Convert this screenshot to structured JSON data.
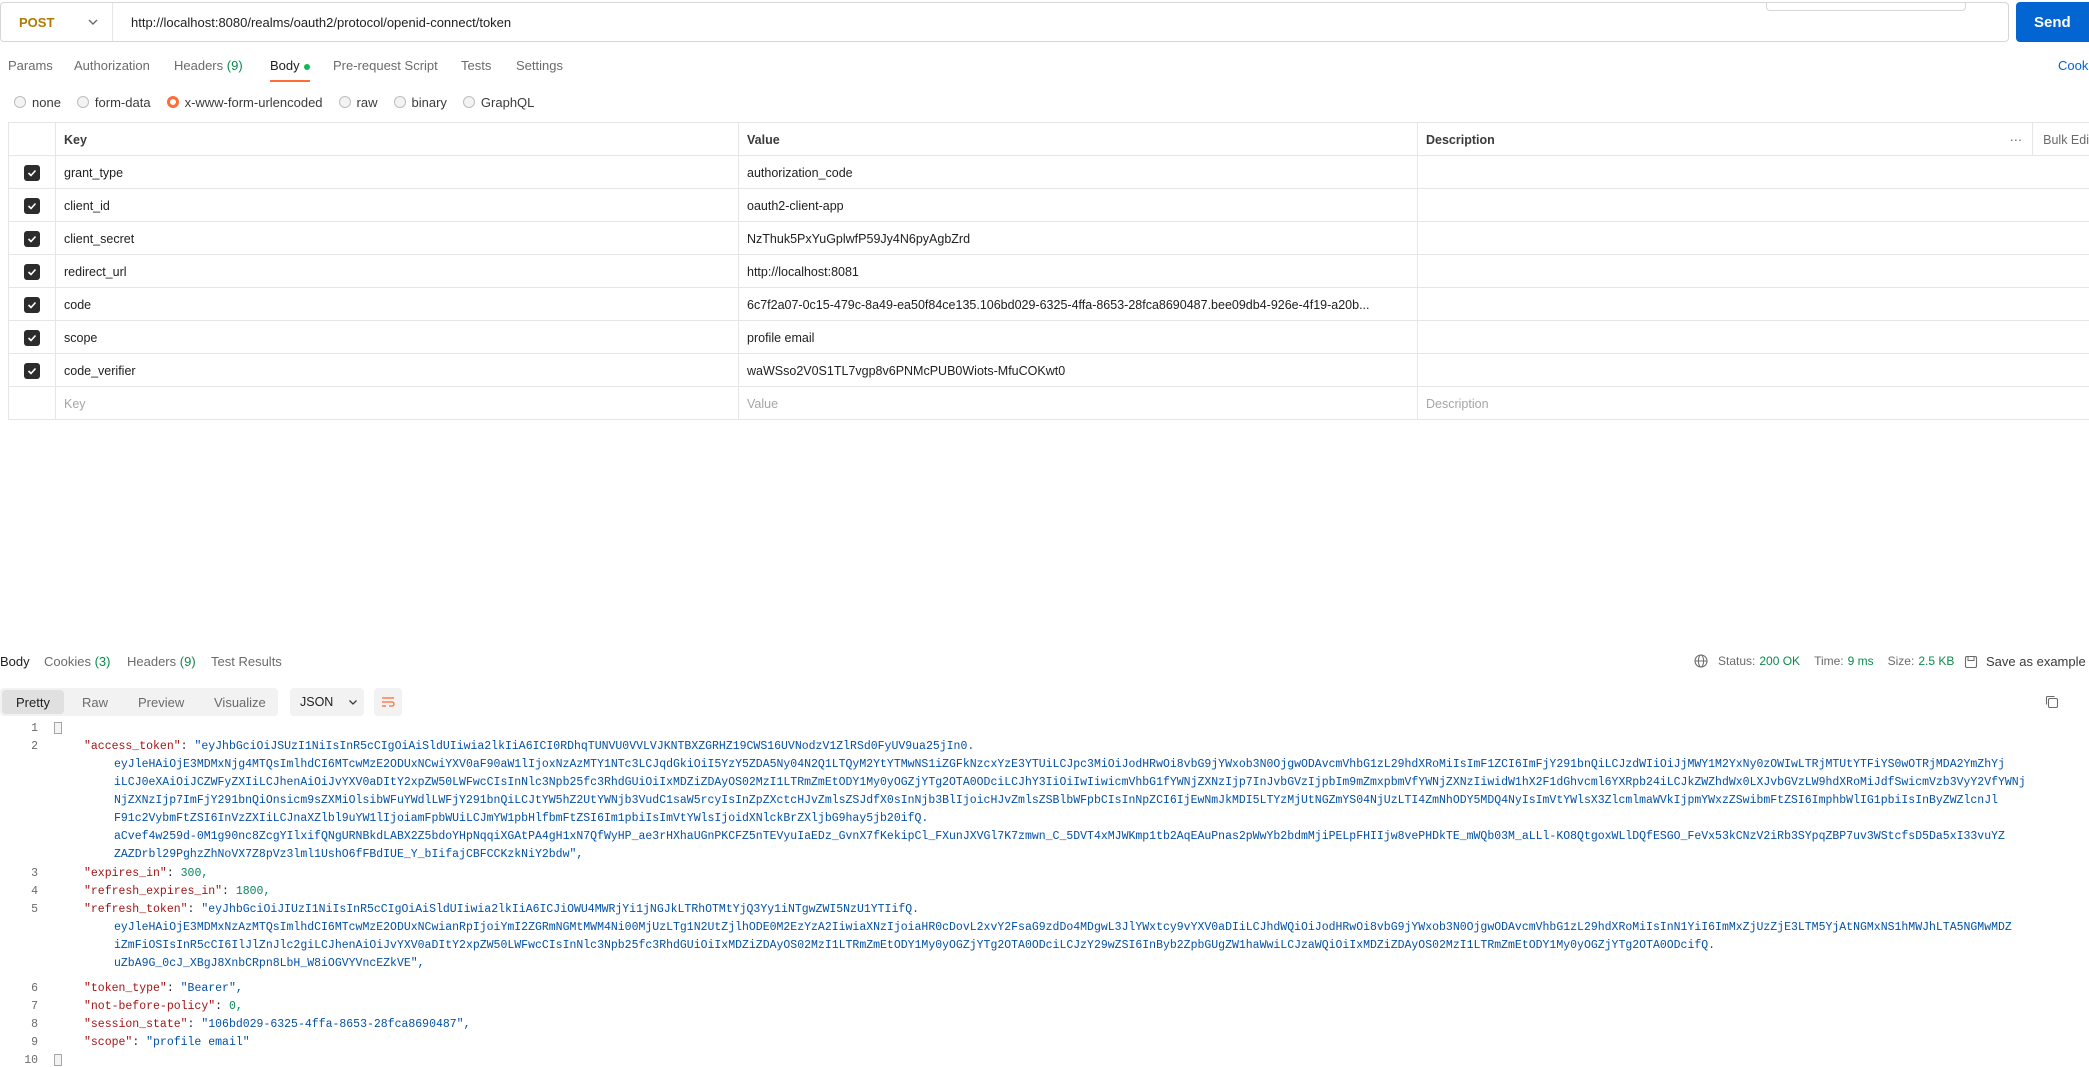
{
  "request": {
    "method": "POST",
    "url": "http://localhost:8080/realms/oauth2/protocol/openid-connect/token",
    "send_label": "Send"
  },
  "tabs": [
    {
      "label": "Params"
    },
    {
      "label": "Authorization"
    },
    {
      "label": "Headers",
      "count": "(9)"
    },
    {
      "label": "Body"
    },
    {
      "label": "Pre-request Script"
    },
    {
      "label": "Tests"
    },
    {
      "label": "Settings"
    }
  ],
  "cookies_label": "Cooki",
  "body_types": [
    "none",
    "form-data",
    "x-www-form-urlencoded",
    "raw",
    "binary",
    "GraphQL"
  ],
  "selected_body_type": "x-www-form-urlencoded",
  "table": {
    "headers": {
      "key": "Key",
      "value": "Value",
      "description": "Description",
      "bulk": "Bulk Edi"
    },
    "rows": [
      {
        "key": "grant_type",
        "value": "authorization_code"
      },
      {
        "key": "client_id",
        "value": "oauth2-client-app"
      },
      {
        "key": "client_secret",
        "value": "NzThuk5PxYuGplwfP59Jy4N6pyAgbZrd"
      },
      {
        "key": "redirect_url",
        "value": "http://localhost:8081"
      },
      {
        "key": "code",
        "value": "6c7f2a07-0c15-479c-8a49-ea50f84ce135.106bd029-6325-4ffa-8653-28fca8690487.bee09db4-926e-4f19-a20b..."
      },
      {
        "key": "scope",
        "value": "profile email"
      },
      {
        "key": "code_verifier",
        "value": "waWSso2V0S1TL7vgp8v6PNMcPUB0Wiots-MfuCOKwt0"
      }
    ],
    "placeholders": {
      "key": "Key",
      "value": "Value",
      "description": "Description"
    }
  },
  "response": {
    "tabs": [
      {
        "label": "Body"
      },
      {
        "label": "Cookies",
        "count": "(3)"
      },
      {
        "label": "Headers",
        "count": "(9)"
      },
      {
        "label": "Test Results"
      }
    ],
    "status_label": "Status:",
    "status_value": "200 OK",
    "time_label": "Time:",
    "time_value": "9 ms",
    "size_label": "Size:",
    "size_value": "2.5 KB",
    "save_label": "Save as example",
    "views": [
      "Pretty",
      "Raw",
      "Preview",
      "Visualize"
    ],
    "format": "JSON",
    "line_numbers": [
      "1",
      "2",
      "3",
      "4",
      "5",
      "6",
      "7",
      "8",
      "9",
      "10"
    ],
    "code_lines": [
      {
        "k": "\"access_token\"",
        "v": "\"eyJhbGciOiJSUzI1NiIsInR5cCIgOiAiSldUIiwia2lkIiA6ICI0RDhqTUNVU0VVLVJKNTBXZGRHZ19CWS16UVNodzV1ZlRSd0FyUV9ua25jIn0."
      },
      {
        "v": "eyJleHAiOjE3MDMxNjg4MTQsImlhdCI6MTcwMzE2ODUxNCwiYXV0aF90aW1lIjoxNzAzMTY1NTc3LCJqdGkiOiI5YzY5ZDA5Ny04N2Q1LTQyM2YtYTMwNS1iZGFkNzcxYzE3YTUiLCJpc3MiOiJodHRwOi8vbG9jYWxob3N0OjgwODAvcmVhbG1zL29hdXRoMiIsImF1ZCI6ImFjY291bnQiLCJzdWIiOiJjMWY1M2YxNy0zOWIwLTRjMTUtYTFiYS0wOTRjMDA2YmZhYj"
      },
      {
        "v": "iLCJ0eXAiOiJCZWFyZXIiLCJhenAiOiJvYXV0aDItY2xpZW50LWFwcCIsInNlc3Npb25fc3RhdGUiOiIxMDZiZDAyOS02MzI1LTRmZmEtODY1My0yOGZjYTg2OTA0ODciLCJhY3IiOiIwIiwicmVhbG1fYWNjZXNzIjp7InJvbGVzIjpbIm9mZmxpbmVfYWNjZXNzIiwidW1hX2F1dGhvcml6YXRpb24iLCJkZWZhdWx0LXJvbGVzLW9hdXRoMiJdfSwicmVzb3VyY2VfYWNj"
      },
      {
        "v": "NjZXNzIjp7ImFjY291bnQiOnsicm9sZXMiOlsibWFuYWdlLWFjY291bnQiLCJtYW5hZ2UtYWNjb3VudC1saW5rcyIsInZpZXctcHJvZmlsZSJdfX0sInNjb3BlIjoicHJvZmlsZSBlbWFpbCIsInNpZCI6IjEwNmJkMDI5LTYzMjUtNGZmYS04NjUzLTI4ZmNhODY5MDQ4NyIsImVtYWlsX3ZlcmlmaWVkIjpmYWxzZSwibmFtZSI6ImphbWlIG1pbiIsInByZWZlcnJl"
      },
      {
        "v": "F91c2VybmFtZSI6InVzZXIiLCJnaXZlbl9uYW1lIjoiamFpbWUiLCJmYW1pbHlfbmFtZSI6Im1pbiIsImVtYWlsIjoidXNlckBrZXljbG9hay5jb20ifQ."
      },
      {
        "v": "aCvef4w259d-0M1g90nc8ZcgYIlxifQNgURNBkdLABX2Z5bdoYHpNqqiXGAtPA4gH1xN7QfWyHP_ae3rHXhaUGnPKCFZ5nTEVyuIaEDz_GvnX7fKekipCl_FXunJXVGl7K7zmwn_C_5DVT4xMJWKmp1tb2AqEAuPnas2pWwYb2bdmMjiPELpFHIIjw8vePHDkTE_mWQb03M_aLLl-KO8QtgoxWLlDQfESGO_FeVx53kCNzV2iRb3SYpqZBP7uv3WStcfsD5Da5xI33vuYZ"
      },
      {
        "v": "ZAZDrbl29PghzZhNoVX7Z8pVz3lml1UshO6fFBdIUE_Y_bIifajCBFCCKzkNiY2bdw\","
      },
      {
        "k": "\"expires_in\"",
        "n": "300,"
      },
      {
        "k": "\"refresh_expires_in\"",
        "n": "1800,"
      },
      {
        "k": "\"refresh_token\"",
        "v": "\"eyJhbGciOiJIUzI1NiIsInR5cCIgOiAiSldUIiwia2lkIiA6ICJiOWU4MWRjYi1jNGJkLTRhOTMtYjQ3Yy1iNTgwZWI5NzU1YTIifQ."
      },
      {
        "v": "eyJleHAiOjE3MDMxNzAzMTQsImlhdCI6MTcwMzE2ODUxNCwianRpIjoiYmI2ZGRmNGMtMWM4Ni00MjUzLTg1N2UtZjlhODE0M2EzYzA2IiwiaXNzIjoiaHR0cDovL2xvY2FsaG9zdDo4MDgwL3JlYWxtcy9vYXV0aDIiLCJhdWQiOiJodHRwOi8vbG9jYWxob3N0OjgwODAvcmVhbG1zL29hdXRoMiIsInN1YiI6ImMxZjUzZjE3LTM5YjAtNGMxNS1hMWJhLTA5NGMwMDZ"
      },
      {
        "v": "iZmFiOSIsInR5cCI6IlJlZnJlc2giLCJhenAiOiJvYXV0aDItY2xpZW50LWFwcCIsInNlc3Npb25fc3RhdGUiOiIxMDZiZDAyOS02MzI1LTRmZmEtODY1My0yOGZjYTg2OTA0ODciLCJzY29wZSI6InByb2ZpbGUgZW1haWwiLCJzaWQiOiIxMDZiZDAyOS02MzI1LTRmZmEtODY1My0yOGZjYTg2OTA0ODcifQ."
      },
      {
        "v": "uZbA9G_0cJ_XBgJ8XnbCRpn8LbH_W8iOGVYVncEZkVE\","
      },
      {
        "k": "\"token_type\"",
        "v": "\"Bearer\","
      },
      {
        "k": "\"not-before-policy\"",
        "n": "0,"
      },
      {
        "k": "\"session_state\"",
        "v": "\"106bd029-6325-4ffa-8653-28fca8690487\","
      },
      {
        "k": "\"scope\"",
        "v": "\"profile email\""
      }
    ]
  },
  "colors": {
    "accent": "#ff6c37",
    "send": "#0265d2",
    "method": "#ad7a03",
    "status_ok": "#0c8a4b"
  }
}
